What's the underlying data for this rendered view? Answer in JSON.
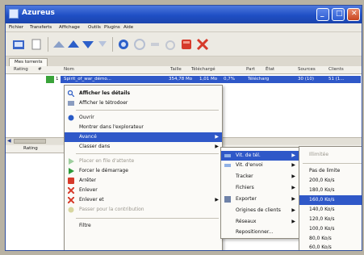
{
  "window": {
    "title": "Azureus",
    "buttons": {
      "minimize": "_",
      "maximize": "□",
      "close": "✕"
    }
  },
  "menubar": [
    "Fichier",
    "Transferts",
    "Affichage",
    "Outils",
    "Plugins",
    "Aide"
  ],
  "toolbar": {
    "icons": [
      "open-icon",
      "new-icon",
      "up-icon",
      "down-icon",
      "stop-icon",
      "refresh-icon",
      "start-icon",
      "pause-icon",
      "remove-icon",
      "delete-icon"
    ],
    "colors": {
      "blue": "#2c5fc9",
      "red": "#d63a2a"
    }
  },
  "tab": {
    "label": "Mes torrents"
  },
  "list": {
    "columns": [
      "Rating",
      "#",
      "Nom",
      "Taille",
      "Téléchargé",
      "Part",
      "État",
      "Sources",
      "Clients"
    ],
    "selected_row": {
      "number": "1",
      "name": "Spirit_of_war_démo...",
      "size": "354,78 Mo",
      "downloaded": "1,01 Mo",
      "share": "0,7%",
      "status": "Télécharg",
      "sources": "30 (10)",
      "clients": "51 (1..."
    }
  },
  "bottom_list": {
    "column": "Rating"
  },
  "context_menu": {
    "items": [
      {
        "label": "Afficher les détails",
        "icon": "details-icon",
        "bold": true
      },
      {
        "label": "Afficher le tétrodoer",
        "icon": "viewer-icon"
      },
      {
        "label": "Ouvrir",
        "icon": "open-icon"
      },
      {
        "label": "Montrer dans l'explorateur"
      },
      {
        "label": "Avancé",
        "highlighted": true,
        "submenu": true
      },
      {
        "label": "Classer dans",
        "submenu": true
      },
      {
        "label": "Placer en file d'attente",
        "icon": "queue-icon",
        "disabled": true
      },
      {
        "label": "Forcer le démarrage",
        "icon": "force-start-icon"
      },
      {
        "label": "Arrêter",
        "icon": "stop-icon"
      },
      {
        "label": "Enlever",
        "icon": "remove-icon"
      },
      {
        "label": "Enlever et",
        "icon": "remove-and-icon",
        "submenu": true
      },
      {
        "label": "Passer pour la contribution",
        "icon": "seed-icon",
        "disabled": true
      },
      {
        "label": "Filtre"
      }
    ]
  },
  "submenu_advanced": {
    "items": [
      {
        "label": "Vit. de tél.",
        "highlighted": true,
        "submenu": true
      },
      {
        "label": "Vit. d'envoi",
        "submenu": true
      },
      {
        "label": "Tracker",
        "submenu": true
      },
      {
        "label": "Fichiers",
        "submenu": true
      },
      {
        "label": "Exporter",
        "icon": "export-icon",
        "submenu": true
      },
      {
        "label": "Origines de clients",
        "submenu": true
      },
      {
        "label": "Réseaux",
        "submenu": true
      },
      {
        "label": "Repositionner..."
      }
    ]
  },
  "submenu_speed": {
    "header": "Illimitée",
    "items": [
      "Pas de limite",
      "200,0 Ko/s",
      "180,0 Ko/s",
      "160,0 Ko/s",
      "140,0 Ko/s",
      "120,0 Ko/s",
      "100,0 Ko/s",
      "80,0 Ko/s",
      "60,0 Ko/s"
    ],
    "highlighted_index": 3
  }
}
